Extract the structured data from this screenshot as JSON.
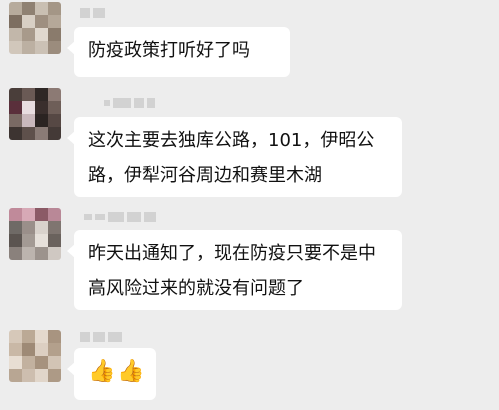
{
  "messages": [
    {
      "sender": "",
      "lines": [
        "防疫政策打听好了吗"
      ]
    },
    {
      "sender": "",
      "lines": [
        "这次主要去独库公路，101，伊昭公",
        "路，伊犁河谷周边和赛里木湖"
      ]
    },
    {
      "sender": "",
      "lines": [
        "昨天出通知了，现在防疫只要不是中",
        "高风险过来的就没有问题了"
      ]
    },
    {
      "sender": "",
      "emoji": "👍👍",
      "emoji_names": [
        "thumbs-up-icon",
        "thumbs-up-icon"
      ]
    }
  ],
  "colors": {
    "background": "#ededed",
    "bubble": "#ffffff",
    "text": "#111111",
    "thumb": "#f5c242"
  }
}
